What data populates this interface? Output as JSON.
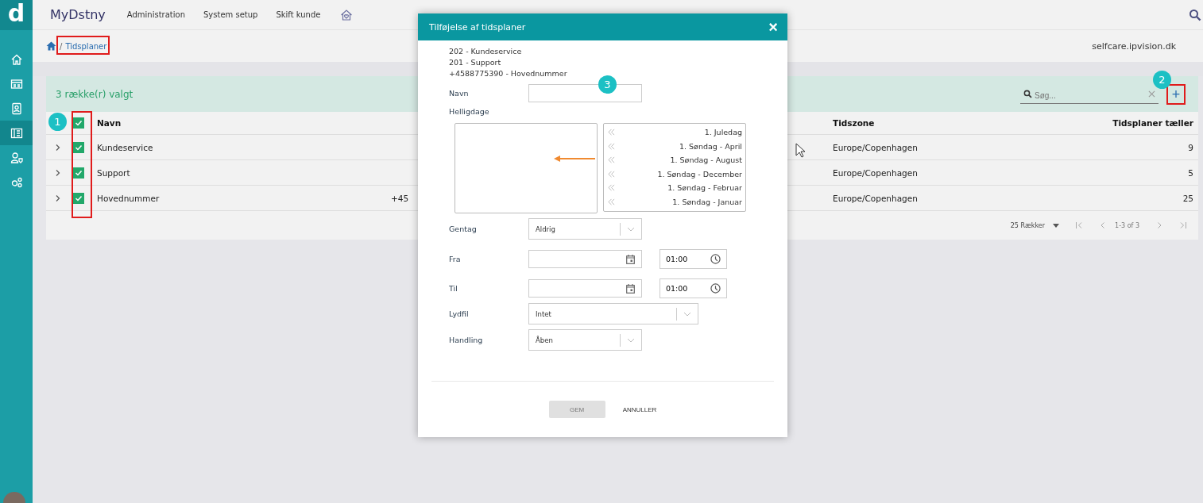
{
  "sidebar": {
    "logo": "d",
    "items": [
      {
        "selected": false
      },
      {
        "selected": false
      },
      {
        "selected": false
      },
      {
        "selected": true
      },
      {
        "selected": false
      },
      {
        "selected": false
      }
    ]
  },
  "topbar": {
    "brand": "MyDstny",
    "nav": [
      "Administration",
      "System setup",
      "Skift kunde"
    ]
  },
  "breadcrumb": {
    "separator": "/",
    "current": "Tidsplaner",
    "host": "selfcare.ipvision.dk"
  },
  "card": {
    "selection_text": "3 række(r) valgt",
    "search": {
      "placeholder": "Søg..."
    },
    "add_label": "+",
    "columns": [
      "Navn",
      "",
      "Tidszone",
      "Tidsplaner tæller"
    ],
    "header_checked": true,
    "rows": [
      {
        "name": "Kundeservice",
        "column_2": "",
        "timezone": "Europe/Copenhagen",
        "count": "9",
        "checked": true
      },
      {
        "name": "Support",
        "column_2": "",
        "timezone": "Europe/Copenhagen",
        "count": "5",
        "checked": true
      },
      {
        "name": "Hovednummer",
        "column_2": "+45",
        "timezone": "Europe/Copenhagen",
        "count": "25",
        "checked": true
      }
    ],
    "pagination": {
      "page_size": "25 Rækker",
      "range": "1-3 of 3"
    }
  },
  "annotations": {
    "badges": [
      "1",
      "2",
      "3"
    ]
  },
  "dialog": {
    "title": "Tilføjelse af tidsplaner",
    "close": "×",
    "targets": [
      "202 - Kundeservice",
      "201 - Support",
      "+4588775390 - Hovednummer"
    ],
    "name_label": "Navn",
    "holidays_label": "Helligdage",
    "holidays_available": [
      "1. Juledag",
      "1. Søndag - April",
      "1. Søndag - August",
      "1. Søndag - December",
      "1. Søndag - Februar",
      "1. Søndag - Januar"
    ],
    "repeat": {
      "label": "Gentag",
      "value": "Aldrig"
    },
    "from": {
      "label": "Fra",
      "time": "01:00"
    },
    "to": {
      "label": "Til",
      "time": "01:00"
    },
    "sound": {
      "label": "Lydfil",
      "value": "Intet"
    },
    "action": {
      "label": "Handling",
      "value": "Åben"
    },
    "buttons": [
      {
        "label": "GEM",
        "disabled": true
      },
      {
        "label": "ANNULLER",
        "disabled": false
      }
    ]
  }
}
